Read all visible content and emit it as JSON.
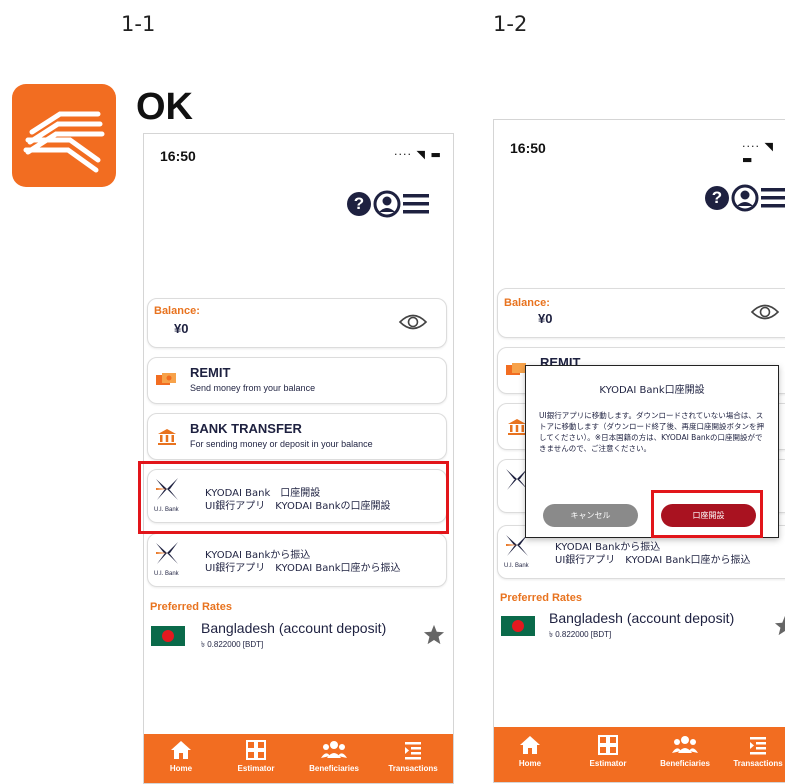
{
  "labels": {
    "step1": "1-1",
    "step2": "1-2",
    "ok": "OK"
  },
  "status": {
    "time": "16:50",
    "icons": "····  ◥ ▬"
  },
  "balance": {
    "label": "Balance:",
    "value": "¥0"
  },
  "remit": {
    "title": "REMIT",
    "subtitle": "Send money from your balance"
  },
  "bank_transfer": {
    "title": "BANK TRANSFER",
    "subtitle": "For sending money or deposit in your balance"
  },
  "kyodai_open": {
    "line1": "KYODAI Bank　口座開設",
    "line2": "UI銀行アプリ　KYODAI Bankの口座開設"
  },
  "kyodai_transfer": {
    "line1": "KYODAI Bankから振込",
    "line2": "UI銀行アプリ　KYODAI Bank口座から振込"
  },
  "ui_bank_logo_text": "U.I. Bank",
  "preferred": {
    "label": "Preferred Rates",
    "name": "Bangladesh (account deposit)",
    "rate": "৳ 0.822000 [BDT]"
  },
  "nav": [
    {
      "label": "Home"
    },
    {
      "label": "Estimator"
    },
    {
      "label": "Beneficiaries"
    },
    {
      "label": "Transactions"
    }
  ],
  "dialog": {
    "title": "KYODAI Bank口座開設",
    "body": "UI銀行アプリに移動します。ダウンロードされていない場合は、ストアに移動します（ダウンロード終了後、再度口座開設ボタンを押してください）。※日本国籍の方は、KYODAI Bankの口座開設ができませんので、ご注意ください。",
    "cancel": "キャンセル",
    "open": "口座開設"
  },
  "colors": {
    "accent": "#f26d21",
    "navy": "#1e2140",
    "highlight": "#e2151a",
    "open_button": "#a91220"
  }
}
